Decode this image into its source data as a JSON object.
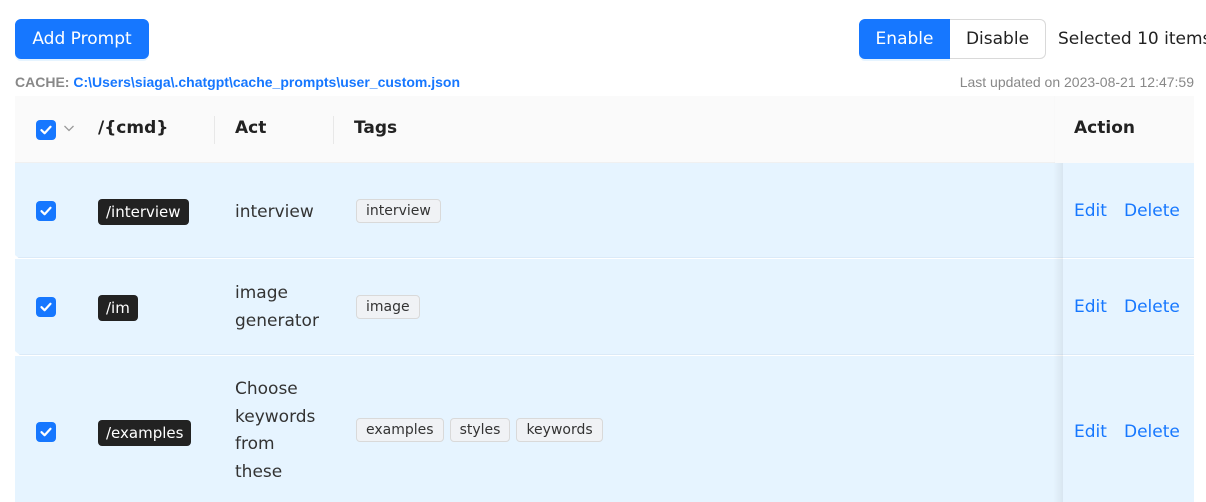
{
  "toolbar": {
    "add_label": "Add Prompt",
    "enable_label": "Enable",
    "disable_label": "Disable",
    "selected_text": "Selected 10 items"
  },
  "cache": {
    "label": "CACHE:",
    "path": "C:\\Users\\siaga\\.chatgpt\\cache_prompts\\user_custom.json",
    "updated": "Last updated on 2023-08-21 12:47:59"
  },
  "table": {
    "headers": {
      "cmd": "/{cmd}",
      "act": "Act",
      "tags": "Tags",
      "action": "Action"
    },
    "rows": [
      {
        "checked": true,
        "cmd": "/interview",
        "act": "interview",
        "tags": [
          "interview"
        ],
        "edit": "Edit",
        "delete": "Delete"
      },
      {
        "checked": true,
        "cmd": "/im",
        "act": "image generator",
        "tags": [
          "image"
        ],
        "edit": "Edit",
        "delete": "Delete"
      },
      {
        "checked": true,
        "cmd": "/examples",
        "act": "Choose keywords from these",
        "tags": [
          "examples",
          "styles",
          "keywords"
        ],
        "edit": "Edit",
        "delete": "Delete"
      }
    ]
  },
  "colors": {
    "primary": "#1677ff",
    "row_selected": "#e6f4ff",
    "header_bg": "#fafafa"
  },
  "icons": {
    "checkbox": "check-icon",
    "chevron": "chevron-down-icon"
  }
}
